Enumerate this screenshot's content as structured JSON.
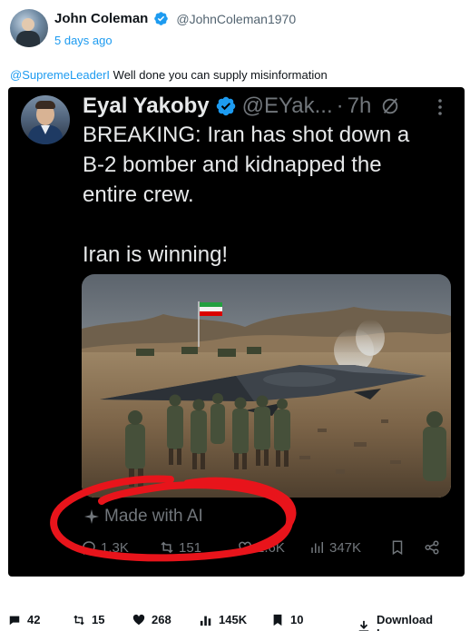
{
  "outer_post": {
    "author_name": "John Coleman",
    "author_handle": "@JohnColeman1970",
    "time": "5 days ago",
    "reply_mention": "@SupremeLeaderI",
    "reply_text": " Well done you can supply misinformation"
  },
  "embedded_tweet": {
    "author_name": "Eyal Yakoby",
    "author_handle": "@EYak...",
    "separator": "·",
    "time": "7h",
    "text_lines": [
      "BREAKING: Iran has shot down a",
      "B-2 bomber and kidnapped the",
      "entire crew."
    ],
    "text_line_last": "Iran is winning!",
    "made_with_ai": "Made with AI",
    "replies": "1.3K",
    "reposts": "151",
    "likes": "1.6K",
    "views": "347K"
  },
  "bottom_bar": {
    "comments": "42",
    "reposts": "15",
    "likes": "268",
    "views": "145K",
    "bookmarks": "10",
    "download_label": "Download Image"
  },
  "colors": {
    "link_blue": "#1d9bf0",
    "embed_background": "#000000",
    "scribble_red": "#e8141b",
    "muted_gray": "#71767b"
  },
  "icons": [
    "verified-badge-icon",
    "grok-icon",
    "more-icon",
    "reply-icon",
    "repost-icon",
    "like-icon",
    "views-icon",
    "bookmark-icon",
    "share-icon",
    "sparkle-icon",
    "comment-icon",
    "download-icon"
  ]
}
